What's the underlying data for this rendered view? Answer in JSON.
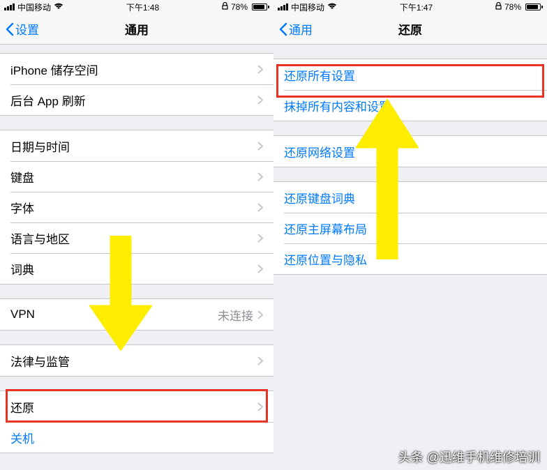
{
  "left": {
    "status": {
      "carrier": "中国移动",
      "time": "下午1:48",
      "battery": "78%"
    },
    "nav": {
      "back": "设置",
      "title": "通用"
    },
    "g1": [
      {
        "label": "iPhone 储存空间"
      },
      {
        "label": "后台 App 刷新"
      }
    ],
    "g2": [
      {
        "label": "日期与时间"
      },
      {
        "label": "键盘"
      },
      {
        "label": "字体"
      },
      {
        "label": "语言与地区"
      },
      {
        "label": "词典"
      }
    ],
    "g3": [
      {
        "label": "VPN",
        "value": "未连接"
      }
    ],
    "g4": [
      {
        "label": "法律与监管"
      }
    ],
    "g5": [
      {
        "label": "还原"
      },
      {
        "label": "关机"
      }
    ]
  },
  "right": {
    "status": {
      "carrier": "中国移动",
      "time": "下午1:47",
      "battery": "78%"
    },
    "nav": {
      "back": "通用",
      "title": "还原"
    },
    "g1": [
      {
        "label": "还原所有设置"
      },
      {
        "label": "抹掉所有内容和设置"
      }
    ],
    "g2": [
      {
        "label": "还原网络设置"
      }
    ],
    "g3": [
      {
        "label": "还原键盘词典"
      },
      {
        "label": "还原主屏幕布局"
      },
      {
        "label": "还原位置与隐私"
      }
    ]
  },
  "watermark": "头条 @迅维手机维修培训"
}
